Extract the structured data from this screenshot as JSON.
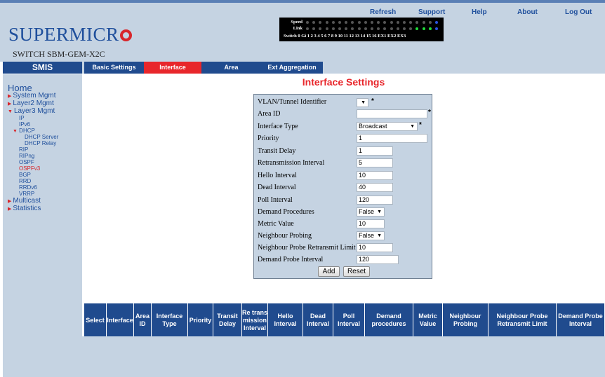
{
  "header": {
    "brand": "SUPERMICR",
    "switch_name": "SWITCH SBM-GEM-X2C",
    "ports": {
      "speed_label": "Speed",
      "link_label": "Link",
      "numbers_label": "Switch 0 Gi 1 2 3 4 5 6 7 8 9 10 11 12 13 14 15 16 EX1 EX2 EX3"
    },
    "nav": [
      "Refresh",
      "Support",
      "Help",
      "About",
      "Log Out"
    ]
  },
  "sidebar": {
    "title": "SMIS",
    "home": "Home",
    "items": [
      "System Mgmt",
      "Layer2 Mgmt",
      "Layer3 Mgmt",
      "Multicast",
      "Statistics"
    ],
    "layer3_sub": [
      "IP",
      "IPv6",
      "DHCP",
      "RIP",
      "RIPng",
      "OSPF",
      "OSPFv3",
      "BGP",
      "RRD",
      "RRDv6",
      "VRRP"
    ],
    "dhcp_sub": [
      "DHCP Server",
      "DHCP Relay"
    ],
    "active_item": "OSPFv3"
  },
  "tabs": [
    "Basic Settings",
    "Interface",
    "Area",
    "Ext Aggregation"
  ],
  "active_tab": "Interface",
  "page_title": "Interface Settings",
  "form": {
    "vlan": {
      "label": "VLAN/Tunnel Identifier",
      "value": ""
    },
    "area_id": {
      "label": "Area ID",
      "value": ""
    },
    "interface_type": {
      "label": "Interface Type",
      "value": "Broadcast"
    },
    "priority": {
      "label": "Priority",
      "value": "1"
    },
    "transit_delay": {
      "label": "Transit Delay",
      "value": "1"
    },
    "retransmission_interval": {
      "label": "Retransmission Interval",
      "value": "5"
    },
    "hello_interval": {
      "label": "Hello Interval",
      "value": "10"
    },
    "dead_interval": {
      "label": "Dead Interval",
      "value": "40"
    },
    "poll_interval": {
      "label": "Poll Interval",
      "value": "120"
    },
    "demand_procedures": {
      "label": "Demand Procedures",
      "value": "False"
    },
    "metric_value": {
      "label": "Metric Value",
      "value": "10"
    },
    "neighbour_probing": {
      "label": "Neighbour Probing",
      "value": "False"
    },
    "neighbour_probe_retransmit_limit": {
      "label": "Neighbour Probe Retransmit Limit",
      "value": "10"
    },
    "demand_probe_interval": {
      "label": "Demand Probe Interval",
      "value": "120"
    },
    "required_mark": "*",
    "add_label": "Add",
    "reset_label": "Reset"
  },
  "table": {
    "headers": [
      "Select",
      "Interface",
      "Area ID",
      "Interface Type",
      "Priority",
      "Transit Delay",
      "Re trans mission Interval",
      "Hello Interval",
      "Dead Interval",
      "Poll Interval",
      "Demand procedures",
      "Metric Value",
      "Neighbour Probing",
      "Neighbour Probe Retransmit Limit",
      "Demand Probe Interval"
    ]
  },
  "colors": {
    "header_bg": "#c5d3e2",
    "nav_dark": "#204b8e",
    "accent_red": "#e8262b",
    "brand_blue": "#1f4f9c"
  }
}
